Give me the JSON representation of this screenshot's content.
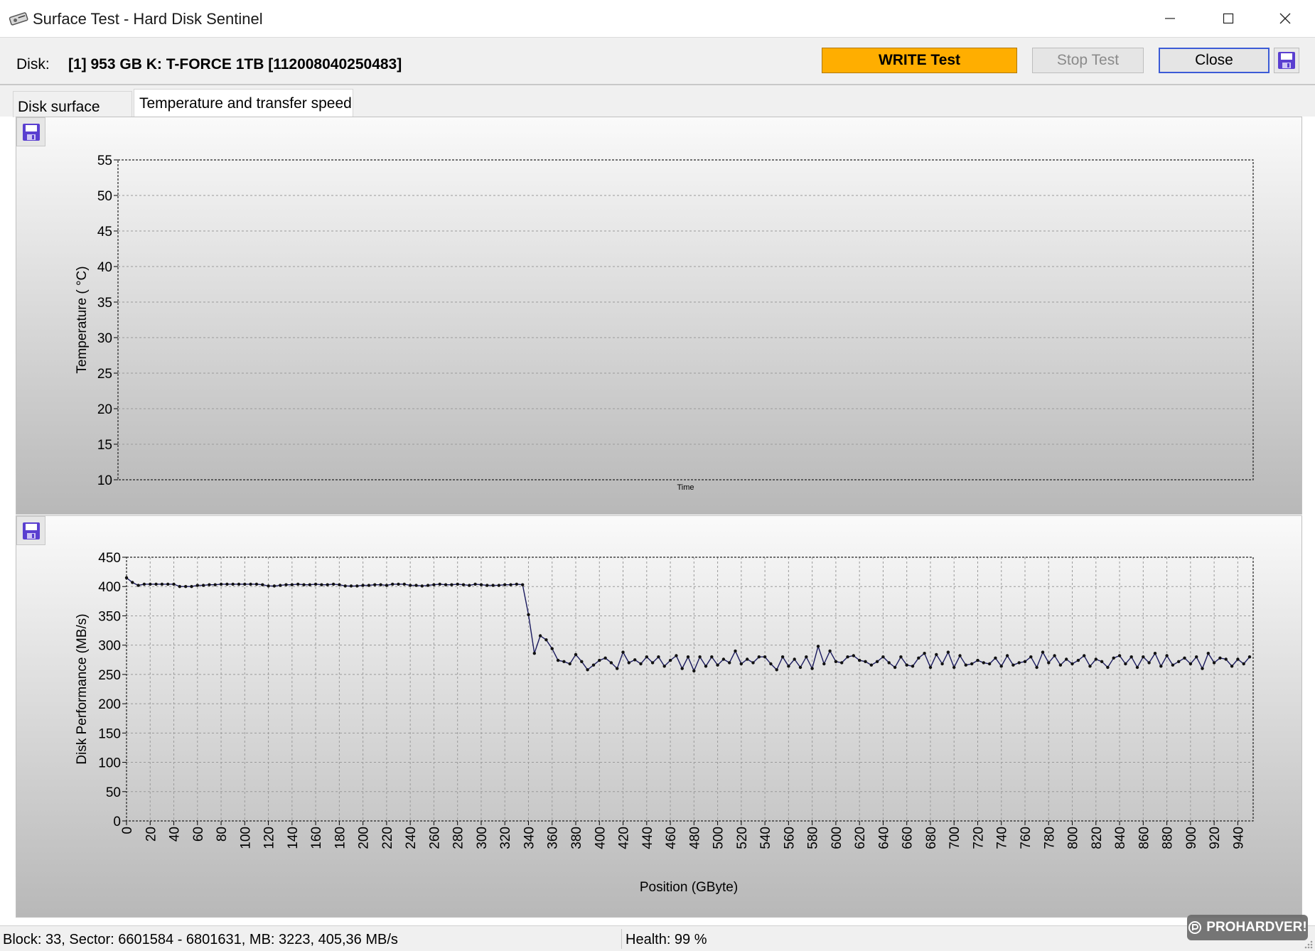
{
  "window": {
    "title": "Surface Test - Hard Disk Sentinel"
  },
  "disk": {
    "label": "Disk:",
    "value": "[1] 953 GB K: T-FORCE 1TB [112008040250483]"
  },
  "buttons": {
    "write": "WRITE Test",
    "stop": "Stop Test",
    "close": "Close"
  },
  "tabs": [
    {
      "label": "Disk surface map",
      "active": false
    },
    {
      "label": "Temperature and transfer speed",
      "active": true
    }
  ],
  "status": {
    "left": "Block: 33, Sector: 6601584 - 6801631, MB: 3223, 405,36 MB/s",
    "health": "Health: 99 %"
  },
  "watermark": "PROHARDVER!",
  "colors": {
    "write_button": "#ffae00",
    "series_line": "#1a1a5e",
    "save_icon": "#5a3fd0"
  },
  "chart_data": [
    {
      "type": "line",
      "title": "",
      "xlabel": "Time",
      "ylabel": "Temperature ( °C)",
      "ylim": [
        10,
        55
      ],
      "yticks": [
        10,
        15,
        20,
        25,
        30,
        35,
        40,
        45,
        50,
        55
      ],
      "grid": true,
      "series": []
    },
    {
      "type": "line",
      "title": "",
      "xlabel": "Position (GByte)",
      "ylabel": "Disk Performance (MB/s)",
      "xlim": [
        0,
        953
      ],
      "ylim": [
        0,
        450
      ],
      "xticks": [
        0,
        20,
        40,
        60,
        80,
        100,
        120,
        140,
        160,
        180,
        200,
        220,
        240,
        260,
        280,
        300,
        320,
        340,
        360,
        380,
        400,
        420,
        440,
        460,
        480,
        500,
        520,
        540,
        560,
        580,
        600,
        620,
        640,
        660,
        680,
        700,
        720,
        740,
        760,
        780,
        800,
        820,
        840,
        860,
        880,
        900,
        920,
        940
      ],
      "yticks": [
        0,
        50,
        100,
        150,
        200,
        250,
        300,
        350,
        400,
        450
      ],
      "grid": true,
      "x": [
        0,
        5,
        10,
        15,
        20,
        25,
        30,
        35,
        40,
        45,
        50,
        55,
        60,
        65,
        70,
        75,
        80,
        85,
        90,
        95,
        100,
        105,
        110,
        115,
        120,
        125,
        130,
        135,
        140,
        145,
        150,
        155,
        160,
        165,
        170,
        175,
        180,
        185,
        190,
        195,
        200,
        205,
        210,
        215,
        220,
        225,
        230,
        235,
        240,
        245,
        250,
        255,
        260,
        265,
        270,
        275,
        280,
        285,
        290,
        295,
        300,
        305,
        310,
        315,
        320,
        325,
        330,
        335,
        340,
        345,
        350,
        355,
        360,
        365,
        370,
        375,
        380,
        385,
        390,
        395,
        400,
        405,
        410,
        415,
        420,
        425,
        430,
        435,
        440,
        445,
        450,
        455,
        460,
        465,
        470,
        475,
        480,
        485,
        490,
        495,
        500,
        505,
        510,
        515,
        520,
        525,
        530,
        535,
        540,
        545,
        550,
        555,
        560,
        565,
        570,
        575,
        580,
        585,
        590,
        595,
        600,
        605,
        610,
        615,
        620,
        625,
        630,
        635,
        640,
        645,
        650,
        655,
        660,
        665,
        670,
        675,
        680,
        685,
        690,
        695,
        700,
        705,
        710,
        715,
        720,
        725,
        730,
        735,
        740,
        745,
        750,
        755,
        760,
        765,
        770,
        775,
        780,
        785,
        790,
        795,
        800,
        805,
        810,
        815,
        820,
        825,
        830,
        835,
        840,
        845,
        850,
        855,
        860,
        865,
        870,
        875,
        880,
        885,
        890,
        895,
        900,
        905,
        910,
        915,
        920,
        925,
        930,
        935,
        940,
        945,
        950
      ],
      "series": [
        {
          "values": [
            415,
            407,
            402,
            404,
            404,
            404,
            404,
            404,
            404,
            400,
            400,
            400,
            402,
            402,
            403,
            403,
            404,
            404,
            404,
            404,
            404,
            404,
            404,
            403,
            401,
            401,
            402,
            403,
            403,
            404,
            403,
            403,
            404,
            403,
            403,
            404,
            403,
            401,
            401,
            401,
            402,
            402,
            403,
            403,
            402,
            404,
            404,
            404,
            402,
            402,
            401,
            402,
            403,
            404,
            403,
            403,
            404,
            403,
            402,
            404,
            403,
            402,
            402,
            402,
            403,
            403,
            404,
            403,
            352,
            286,
            316,
            309,
            294,
            274,
            272,
            268,
            284,
            272,
            258,
            266,
            274,
            278,
            270,
            260,
            288,
            270,
            275,
            268,
            280,
            270,
            280,
            264,
            274,
            282,
            260,
            280,
            256,
            280,
            264,
            280,
            266,
            276,
            270,
            290,
            268,
            276,
            270,
            280,
            280,
            268,
            258,
            280,
            264,
            276,
            262,
            280,
            260,
            298,
            268,
            290,
            272,
            270,
            280,
            282,
            274,
            272,
            266,
            272,
            280,
            270,
            262,
            280,
            266,
            264,
            278,
            286,
            262,
            284,
            268,
            288,
            262,
            282,
            266,
            268,
            274,
            270,
            268,
            278,
            264,
            282,
            266,
            270,
            272,
            280,
            262,
            288,
            270,
            282,
            266,
            276,
            268,
            274,
            282,
            264,
            276,
            272,
            262,
            278,
            282,
            268,
            280,
            262,
            280,
            270,
            286,
            264,
            282,
            266,
            272,
            278,
            268,
            280,
            260,
            286,
            270,
            278,
            276,
            264,
            276,
            268,
            280,
            264,
            270,
            276,
            260,
            270,
            284,
            258,
            270,
            282,
            276,
            264,
            270,
            276,
            272,
            284,
            268,
            282,
            278,
            264,
            276,
            288,
            270,
            282,
            274,
            276,
            262,
            266,
            268,
            270,
            274,
            256,
            278,
            282,
            266,
            284,
            272,
            264,
            262,
            278,
            272,
            260,
            282,
            268,
            286,
            274,
            278,
            280
          ]
        }
      ]
    }
  ]
}
